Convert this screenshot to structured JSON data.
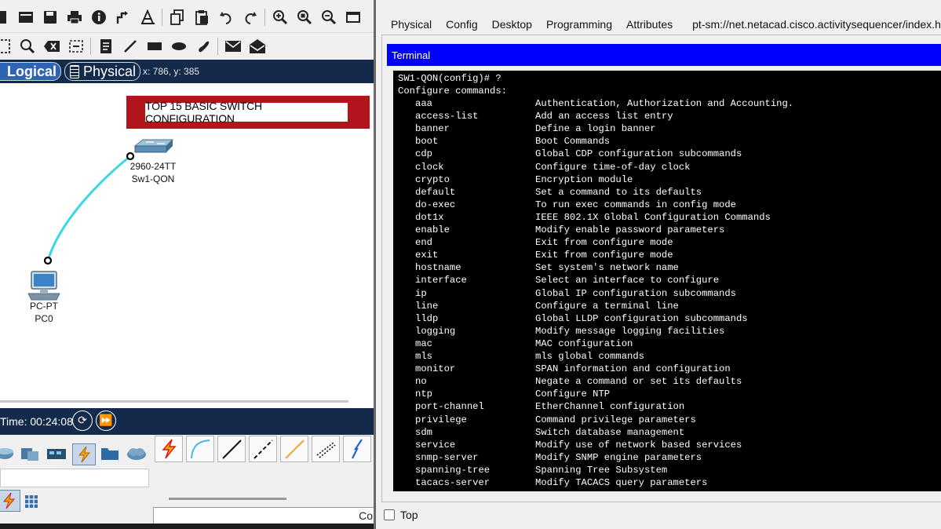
{
  "mode_bar": {
    "logical_label": "Logical",
    "physical_label": "Physical",
    "coordinates": "x: 786, y: 385"
  },
  "workspace": {
    "banner_text": "TOP 15 BASIC SWITCH CONFIGURATION",
    "switch": {
      "model": "2960-24TT",
      "name": "Sw1-QON"
    },
    "pc": {
      "model": "PC-PT",
      "name": "PC0"
    }
  },
  "timebar": {
    "time_label": "Time: 00:24:08"
  },
  "status": {
    "text": "Co"
  },
  "device_window": {
    "tabs": [
      "Physical",
      "Config",
      "Desktop",
      "Programming",
      "Attributes",
      "pt-sm://net.netacad.cisco.activitysequencer/index.html"
    ],
    "active_tab": "Desktop",
    "terminal_title": "Terminal",
    "top_checkbox_label": "Top",
    "terminal": {
      "prompt_line": "SW1-QON(config)# ?",
      "header_line": "Configure commands:",
      "commands": [
        {
          "cmd": "aaa",
          "desc": "Authentication, Authorization and Accounting."
        },
        {
          "cmd": "access-list",
          "desc": "Add an access list entry"
        },
        {
          "cmd": "banner",
          "desc": "Define a login banner"
        },
        {
          "cmd": "boot",
          "desc": "Boot Commands"
        },
        {
          "cmd": "cdp",
          "desc": "Global CDP configuration subcommands"
        },
        {
          "cmd": "clock",
          "desc": "Configure time-of-day clock"
        },
        {
          "cmd": "crypto",
          "desc": "Encryption module"
        },
        {
          "cmd": "default",
          "desc": "Set a command to its defaults"
        },
        {
          "cmd": "do-exec",
          "desc": "To run exec commands in config mode"
        },
        {
          "cmd": "dot1x",
          "desc": "IEEE 802.1X Global Configuration Commands"
        },
        {
          "cmd": "enable",
          "desc": "Modify enable password parameters"
        },
        {
          "cmd": "end",
          "desc": "Exit from configure mode"
        },
        {
          "cmd": "exit",
          "desc": "Exit from configure mode"
        },
        {
          "cmd": "hostname",
          "desc": "Set system's network name"
        },
        {
          "cmd": "interface",
          "desc": "Select an interface to configure"
        },
        {
          "cmd": "ip",
          "desc": "Global IP configuration subcommands"
        },
        {
          "cmd": "line",
          "desc": "Configure a terminal line"
        },
        {
          "cmd": "lldp",
          "desc": "Global LLDP configuration subcommands"
        },
        {
          "cmd": "logging",
          "desc": "Modify message logging facilities"
        },
        {
          "cmd": "mac",
          "desc": "MAC configuration"
        },
        {
          "cmd": "mls",
          "desc": "mls global commands"
        },
        {
          "cmd": "monitor",
          "desc": "SPAN information and configuration"
        },
        {
          "cmd": "no",
          "desc": "Negate a command or set its defaults"
        },
        {
          "cmd": "ntp",
          "desc": "Configure NTP"
        },
        {
          "cmd": "port-channel",
          "desc": "EtherChannel configuration"
        },
        {
          "cmd": "privilege",
          "desc": "Command privilege parameters"
        },
        {
          "cmd": "sdm",
          "desc": "Switch database management"
        },
        {
          "cmd": "service",
          "desc": "Modify use of network based services"
        },
        {
          "cmd": "snmp-server",
          "desc": "Modify SNMP engine parameters"
        },
        {
          "cmd": "spanning-tree",
          "desc": "Spanning Tree Subsystem"
        },
        {
          "cmd": "tacacs-server",
          "desc": "Modify TACACS query parameters"
        }
      ]
    }
  },
  "colors": {
    "mode_bar_bg": "#142a4a",
    "logical_tab_bg": "#2d64b3",
    "banner_red": "#b2141c",
    "link_cyan": "#3ad8e6",
    "terminal_header_blue": "#0000ff",
    "terminal_bg": "#000000",
    "terminal_text": "#ffffff"
  },
  "icons": {
    "toolbar_row1": [
      "file-icon",
      "workspace-icon",
      "save-icon",
      "print-icon",
      "info-icon",
      "activity-wizard-icon",
      "text-icon",
      "copy-icon",
      "paste-icon",
      "undo-icon",
      "redo-icon",
      "zoom-in-icon",
      "zoom-reset-icon",
      "zoom-out-icon",
      "window-icon"
    ],
    "toolbar_row2": [
      "select-icon",
      "inspect-icon",
      "delete-icon",
      "resize-icon",
      "note-icon",
      "line-draw-icon",
      "rectangle-icon",
      "ellipse-icon",
      "freeform-icon",
      "simple-pdu-icon",
      "complex-pdu-icon"
    ],
    "device_categories": [
      "routers-icon",
      "switches-icon",
      "hubs-icon",
      "connections-icon",
      "end-devices-icon",
      "wan-emulation-icon"
    ],
    "cables": [
      "auto-connection-icon",
      "console-cable-icon",
      "straight-through-icon",
      "crossover-icon",
      "fiber-icon",
      "phone-cable-icon",
      "serial-dce-icon"
    ]
  }
}
